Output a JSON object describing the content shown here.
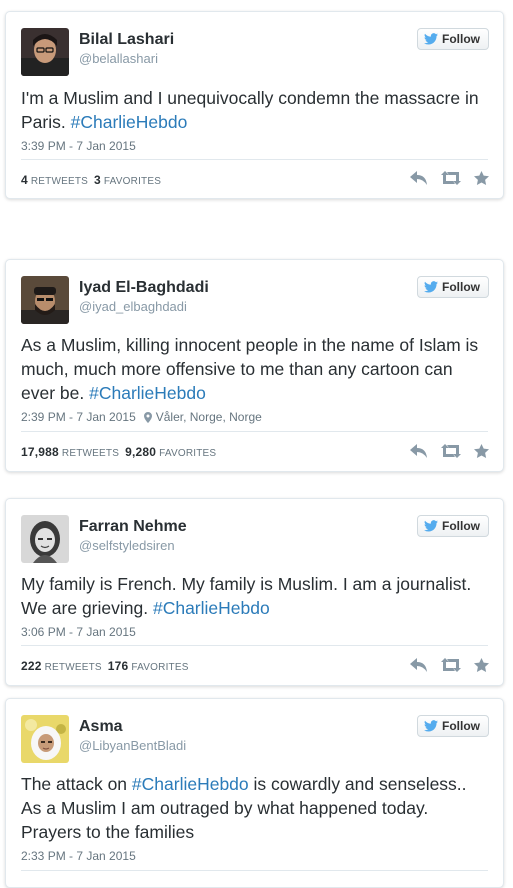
{
  "tweets": [
    {
      "name": "Bilal Lashari",
      "handle": "@belallashari",
      "follow_label": "Follow",
      "text_before": "I'm a Muslim and I unequivocally condemn the massacre in Paris. ",
      "hashtag": "#CharlieHebdo",
      "text_after": "",
      "timestamp": "3:39 PM - 7 Jan 2015",
      "location": "",
      "retweets": "4",
      "retweets_label": "RETWEETS",
      "favorites": "3",
      "favorites_label": "FAVORITES"
    },
    {
      "name": "Iyad El-Baghdadi",
      "handle": "@iyad_elbaghdadi",
      "follow_label": "Follow",
      "text_before": "As a Muslim, killing innocent people in the name of Islam is much, much more offensive to me than any cartoon can ever be. ",
      "hashtag": "#CharlieHebdo",
      "text_after": "",
      "timestamp": "2:39 PM - 7 Jan 2015",
      "location": "Våler, Norge, Norge",
      "retweets": "17,988",
      "retweets_label": "RETWEETS",
      "favorites": "9,280",
      "favorites_label": "FAVORITES"
    },
    {
      "name": "Farran Nehme",
      "handle": "@selfstyledsiren",
      "follow_label": "Follow",
      "text_before": "My family is French. My family is Muslim. I am a journalist. We are grieving. ",
      "hashtag": "#CharlieHebdo",
      "text_after": "",
      "timestamp": "3:06 PM - 7 Jan 2015",
      "location": "",
      "retweets": "222",
      "retweets_label": "RETWEETS",
      "favorites": "176",
      "favorites_label": "FAVORITES"
    },
    {
      "name": "Asma",
      "handle": "@LibyanBentBladi",
      "follow_label": "Follow",
      "text_before": "The attack on ",
      "hashtag": "#CharlieHebdo",
      "text_after": " is cowardly and senseless.. As a Muslim I am outraged by what happened today. Prayers to the families",
      "timestamp": "2:33 PM - 7 Jan 2015",
      "location": "",
      "retweets": "",
      "retweets_label": "",
      "favorites": "",
      "favorites_label": ""
    }
  ],
  "icons": {
    "follow": "twitter-bird-icon",
    "reply": "reply-icon",
    "retweet": "retweet-icon",
    "favorite": "star-icon",
    "location": "location-pin-icon"
  },
  "colors": {
    "hashtag": "#2b7bb9",
    "bird": "#55acee",
    "muted": "#66757f",
    "action_icon": "#8899a6"
  }
}
